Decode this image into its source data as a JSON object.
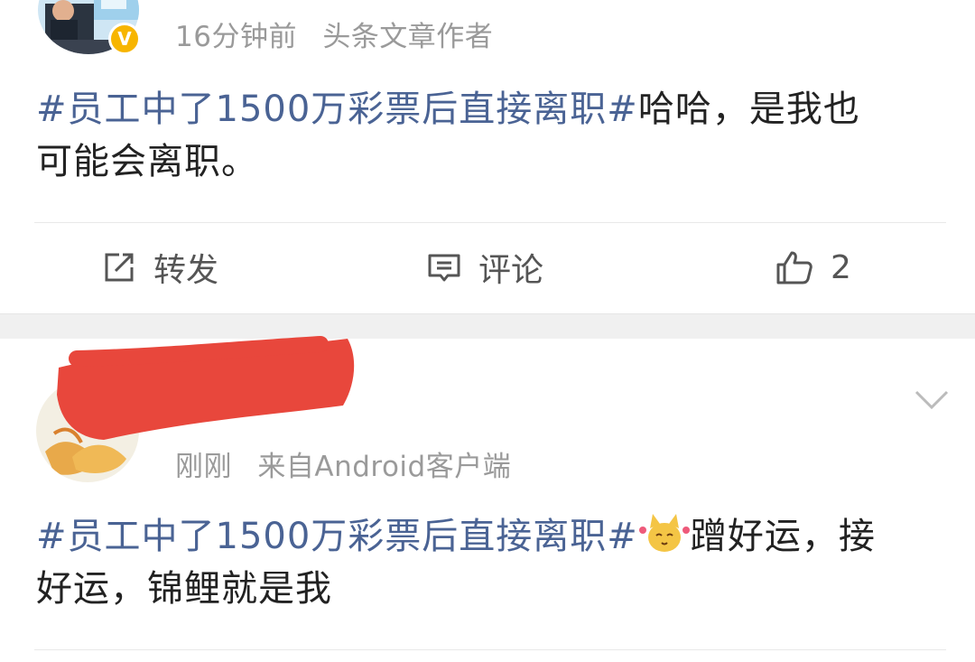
{
  "post1": {
    "meta_time": "16分钟前",
    "meta_source": "头条文章作者",
    "verified_badge": "V",
    "hashtag": "#员工中了1500万彩票后直接离职#",
    "text_line1_rest": "哈哈，是我也",
    "text_line2": "可能会离职。",
    "actions": {
      "repost_label": "转发",
      "comment_label": "评论",
      "like_count": "2"
    }
  },
  "post2": {
    "meta_time": "刚刚",
    "meta_source": "来自Android客户端",
    "hashtag": "#员工中了1500万彩票后直接离职#",
    "text_line1_rest": "蹭好运，接",
    "text_line2": "好运，锦鲤就是我"
  },
  "colors": {
    "hashtag": "#4a6394",
    "meta": "#9a9a9a",
    "badge": "#f7b500",
    "redaction": "#e8473c"
  },
  "icons": [
    "repost-icon",
    "comment-icon",
    "like-icon",
    "chevron-down-icon",
    "cat-emoji-icon"
  ]
}
